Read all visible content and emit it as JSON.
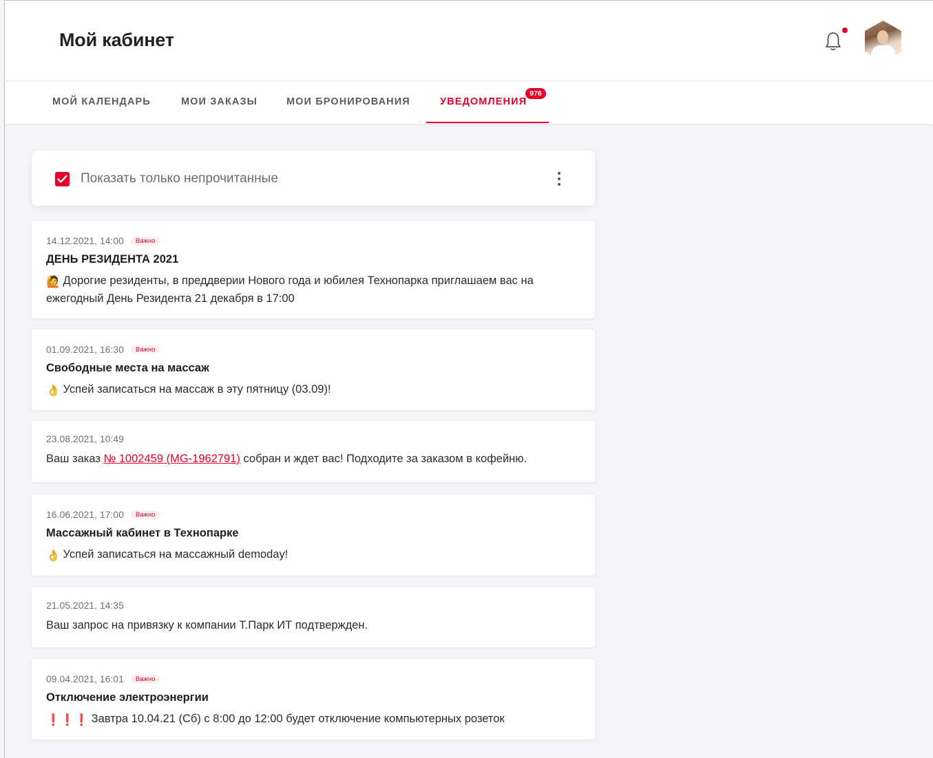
{
  "header": {
    "title": "Мой кабинет",
    "bell_icon": "bell-icon",
    "avatar": "user-avatar"
  },
  "tabs": [
    {
      "label": "МОЙ КАЛЕНДАРЬ",
      "active": false
    },
    {
      "label": "МОИ ЗАКАЗЫ",
      "active": false
    },
    {
      "label": "МОИ БРОНИРОВАНИЯ",
      "active": false
    },
    {
      "label": "УВЕДОМЛЕНИЯ",
      "active": true,
      "badge": "976"
    }
  ],
  "filter": {
    "label": "Показать только непрочитанные",
    "checked": true
  },
  "colors": {
    "accent": "#e4002b",
    "background": "#f3f4f7"
  },
  "notifications": [
    {
      "date": "14.12.2021, 14:00",
      "badge": "Важно",
      "title": "ДЕНЬ РЕЗИДЕНТА 2021",
      "icon": "🙋",
      "text": "Дорогие резиденты, в преддверии Нового года и юбилея Технопарка приглашаем вас на ежегодный День Резидента 21 декабря в 17:00"
    },
    {
      "date": "01.09.2021, 16:30",
      "badge": "Важно",
      "title": "Свободные места на массаж",
      "icon": "👌",
      "text": "Успей записаться на массаж в эту пятницу (03.09)!"
    },
    {
      "date": "23.08.2021, 10:49",
      "text_before": "Ваш заказ ",
      "link": "№ 1002459 (MG-1962791)",
      "text_after": " собран и ждет вас! Подходите за заказом в кофейню."
    },
    {
      "date": "16.06.2021, 17:00",
      "badge": "Важно",
      "title": "Массажный кабинет в Технопарке",
      "icon": "👌",
      "text": "Успей записаться на массажный demoday!"
    },
    {
      "date": "21.05.2021, 14:35",
      "text": "Ваш запрос на привязку к компании Т.Парк ИТ подтвержден."
    },
    {
      "date": "09.04.2021, 16:01",
      "badge": "Важно",
      "title": "Отключение электроэнергии",
      "icon": "❗❗❗",
      "text": "Завтра 10.04.21 (Сб) с 8:00 до 12:00 будет отключение компьютерных розеток"
    }
  ]
}
